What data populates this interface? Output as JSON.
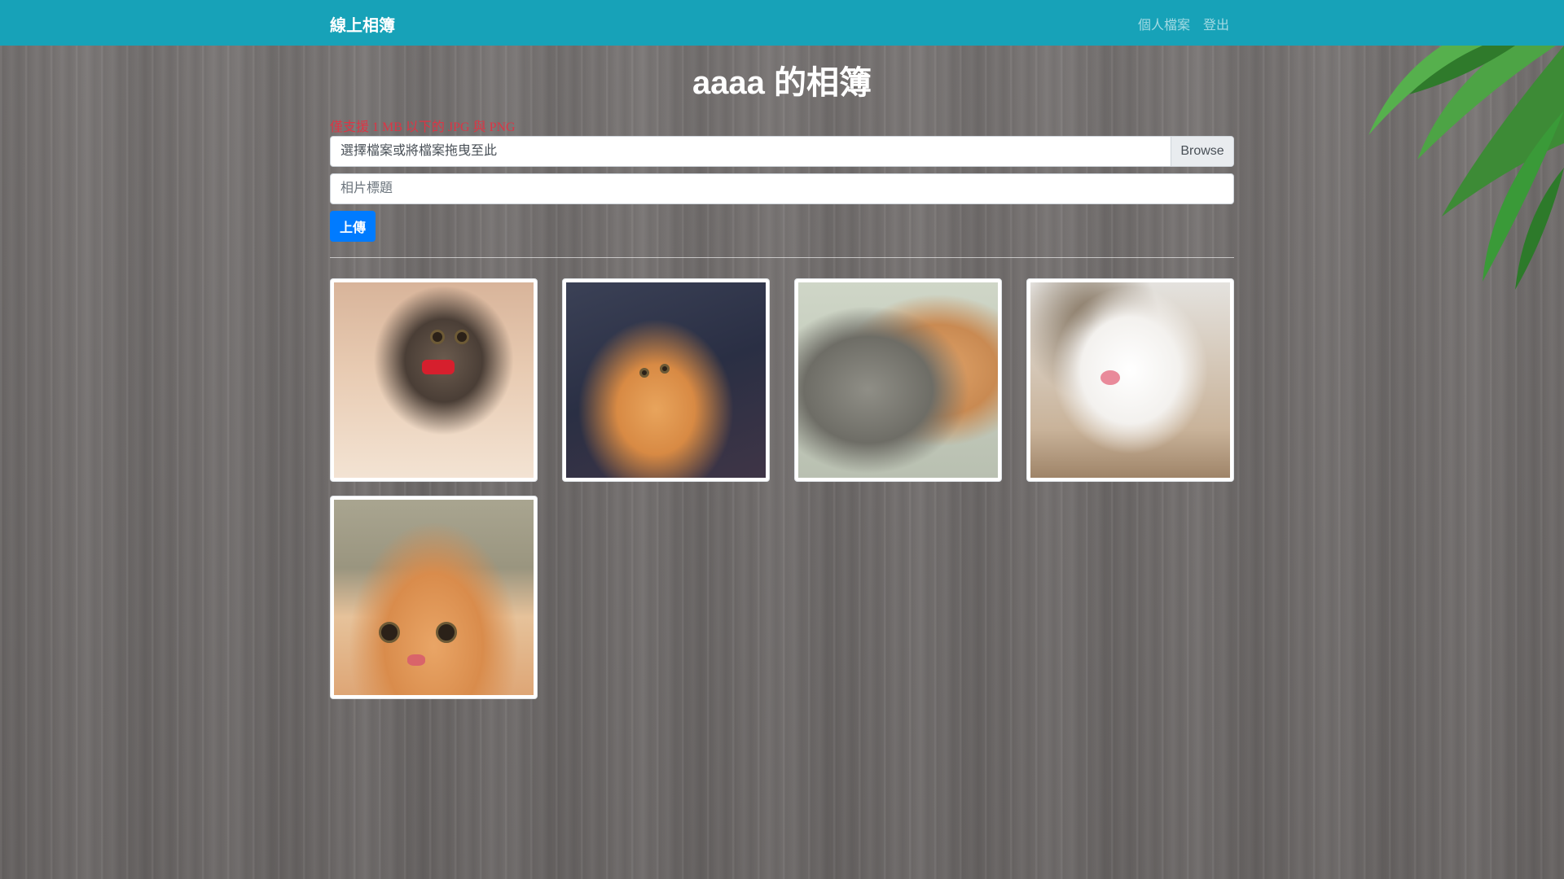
{
  "navbar": {
    "brand": "線上相簿",
    "links": [
      "個人檔案",
      "登出"
    ]
  },
  "main": {
    "title": "aaaa 的相簿",
    "hint": "僅支援 1 MB 以下的 JPG 與 PNG",
    "file_input": {
      "label": "選擇檔案或將檔案拖曳至此",
      "browse": "Browse"
    },
    "photo_title_placeholder": "相片標題",
    "upload_label": "上傳"
  },
  "gallery": {
    "photos": [
      {
        "subject": "tabby kitten with red bow"
      },
      {
        "subject": "orange kitten lying on back"
      },
      {
        "subject": "gray and orange cats cuddling"
      },
      {
        "subject": "white and tabby cat sleeping"
      },
      {
        "subject": "orange kitten wearing knit hat"
      }
    ]
  },
  "colors": {
    "navbar": "#17a2b8",
    "primary": "#007bff",
    "hint": "#dc3545"
  }
}
